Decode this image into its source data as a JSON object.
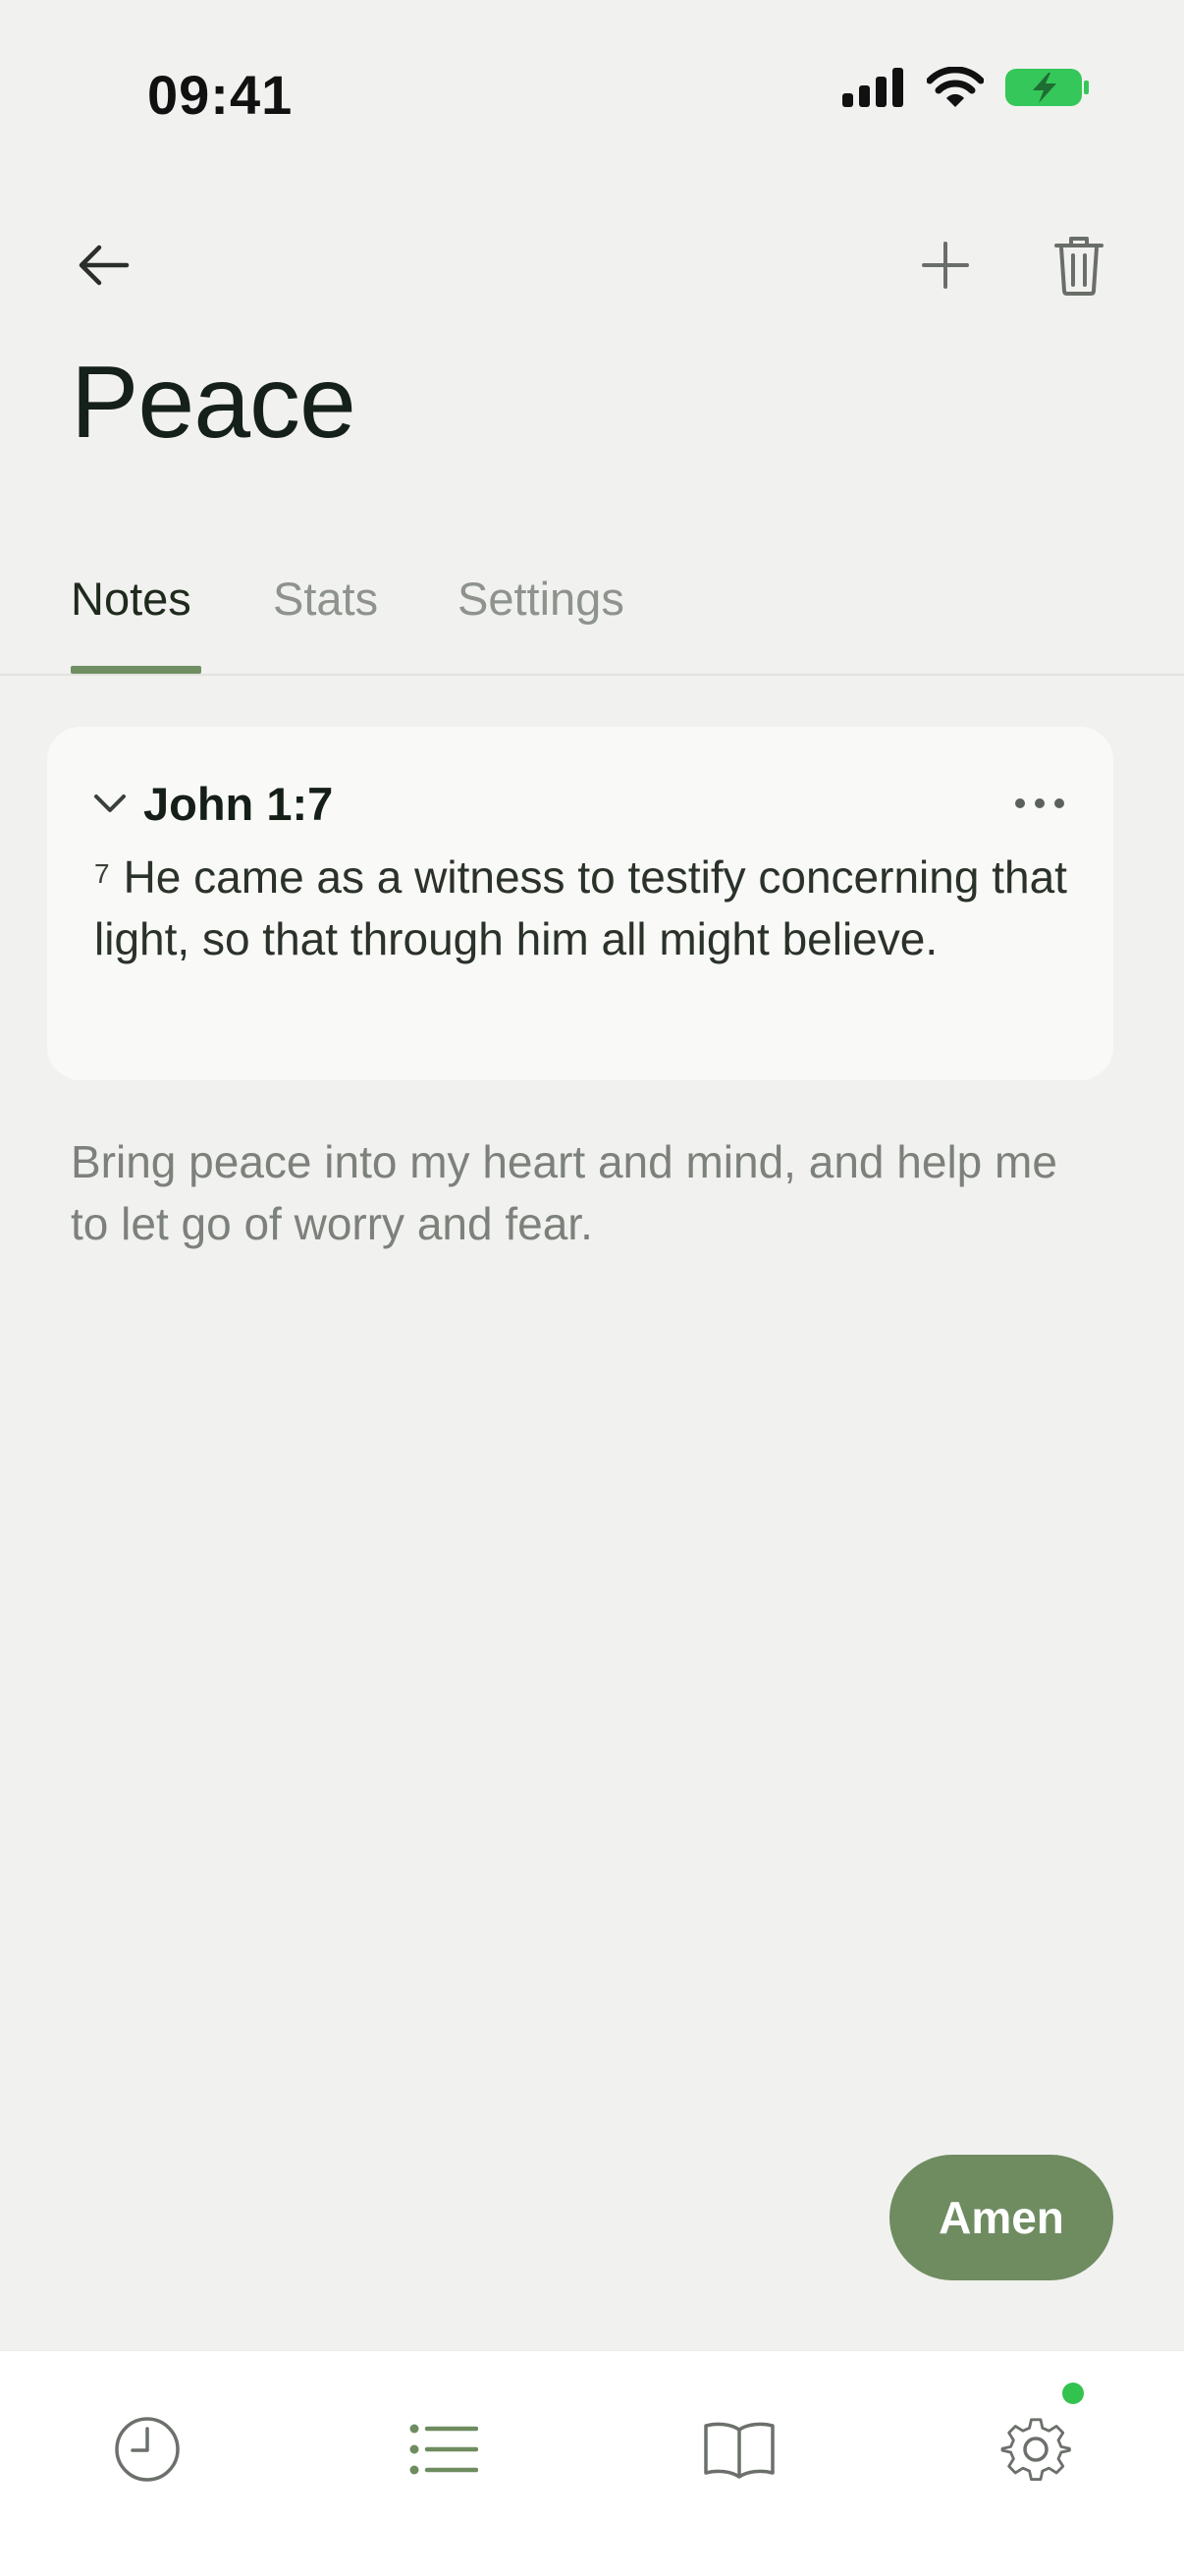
{
  "status_bar": {
    "time": "09:41"
  },
  "page": {
    "title": "Peace"
  },
  "tabs": [
    {
      "label": "Notes",
      "active": true
    },
    {
      "label": "Stats",
      "active": false
    },
    {
      "label": "Settings",
      "active": false
    }
  ],
  "verse_card": {
    "reference": "John 1:7",
    "verse_number": "7",
    "verse_text": "He came as a witness to testify concerning that light, so that through him all might believe."
  },
  "note": {
    "text": "Bring peace into my heart and mind, and help me to let go of worry and fear."
  },
  "action": {
    "amen_label": "Amen"
  },
  "bottom_nav": {
    "items": [
      {
        "icon": "clock-icon",
        "active": false
      },
      {
        "icon": "list-icon",
        "active": true
      },
      {
        "icon": "book-icon",
        "active": false
      },
      {
        "icon": "gear-icon",
        "active": false,
        "badge": true
      }
    ]
  },
  "colors": {
    "accent": "#6e8c60",
    "background": "#f1f1ef",
    "card": "#f9f9f8",
    "badge": "#34c24f",
    "battery": "#35c759"
  }
}
